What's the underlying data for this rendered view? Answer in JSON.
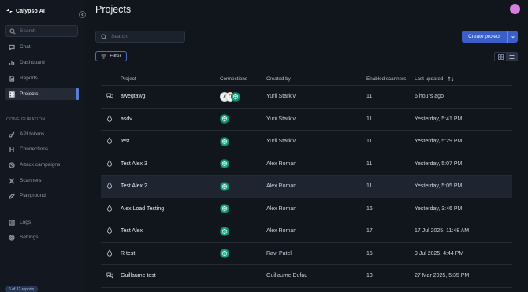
{
  "app": {
    "name": "Calypso AI"
  },
  "sidebar": {
    "search_placeholder": "Search",
    "items": [
      {
        "label": "Chat",
        "icon": "chat-icon"
      },
      {
        "label": "Dashboard",
        "icon": "chart-icon"
      },
      {
        "label": "Reports",
        "icon": "document-icon"
      },
      {
        "label": "Projects",
        "icon": "grid-icon",
        "active": true
      }
    ],
    "config_label": "CONFIGURATION",
    "config_items": [
      {
        "label": "API tokens",
        "icon": "key-icon"
      },
      {
        "label": "Connections",
        "icon": "connections-icon"
      },
      {
        "label": "Attack campaigns",
        "icon": "target-icon"
      },
      {
        "label": "Scanners",
        "icon": "scanner-icon"
      },
      {
        "label": "Playground",
        "icon": "pen-icon"
      }
    ],
    "bottom_items": [
      {
        "label": "Logs",
        "icon": "logs-icon"
      },
      {
        "label": "Settings",
        "icon": "gear-icon"
      }
    ],
    "reports_badge": "6 of 12 reports"
  },
  "header": {
    "title": "Projects",
    "search_placeholder": "Search",
    "create_label": "Create project",
    "filter_label": "Filter"
  },
  "table": {
    "columns": {
      "project": "Project",
      "connections": "Connections",
      "created_by": "Created by",
      "scanners": "Enabled scanners",
      "updated": "Last updated"
    },
    "rows": [
      {
        "name": "awegtawg",
        "icon": "chat-bubbles-icon",
        "connections": "multi",
        "created_by": "Yurii Starkiv",
        "scanners": "11",
        "updated": "6 hours ago"
      },
      {
        "name": "asdv",
        "icon": "drop-icon",
        "connections": "single",
        "created_by": "Yurii Starkiv",
        "scanners": "11",
        "updated": "Yesterday, 5:41 PM"
      },
      {
        "name": "test",
        "icon": "drop-icon",
        "connections": "single",
        "created_by": "Yurii Starkiv",
        "scanners": "11",
        "updated": "Yesterday, 5:29 PM"
      },
      {
        "name": "Test Alex 3",
        "icon": "drop-icon",
        "connections": "single",
        "created_by": "Alex Roman",
        "scanners": "11",
        "updated": "Yesterday, 5:07 PM"
      },
      {
        "name": "Test Alex 2",
        "icon": "drop-icon",
        "connections": "single",
        "created_by": "Alex Roman",
        "scanners": "11",
        "updated": "Yesterday, 5:05 PM",
        "highlight": true
      },
      {
        "name": "Alex Load Testing",
        "icon": "drop-icon",
        "connections": "single",
        "created_by": "Alex Roman",
        "scanners": "16",
        "updated": "Yesterday, 3:46 PM"
      },
      {
        "name": "Test Alex",
        "icon": "drop-icon",
        "connections": "single",
        "created_by": "Alex Roman",
        "scanners": "17",
        "updated": "17 Jul 2025, 11:48 AM"
      },
      {
        "name": "R test",
        "icon": "drop-icon",
        "connections": "single",
        "created_by": "Ravi Patel",
        "scanners": "15",
        "updated": "9 Jul 2025, 4:44 PM"
      },
      {
        "name": "Guillaume test",
        "icon": "chat-bubbles-icon",
        "connections": "-",
        "created_by": "Guillaume Dufau",
        "scanners": "13",
        "updated": "27 Mar 2025, 5:35 PM"
      }
    ]
  },
  "colors": {
    "accent": "#3a5fc8",
    "connection": "#11a37f",
    "avatar": "#d77fe0"
  }
}
